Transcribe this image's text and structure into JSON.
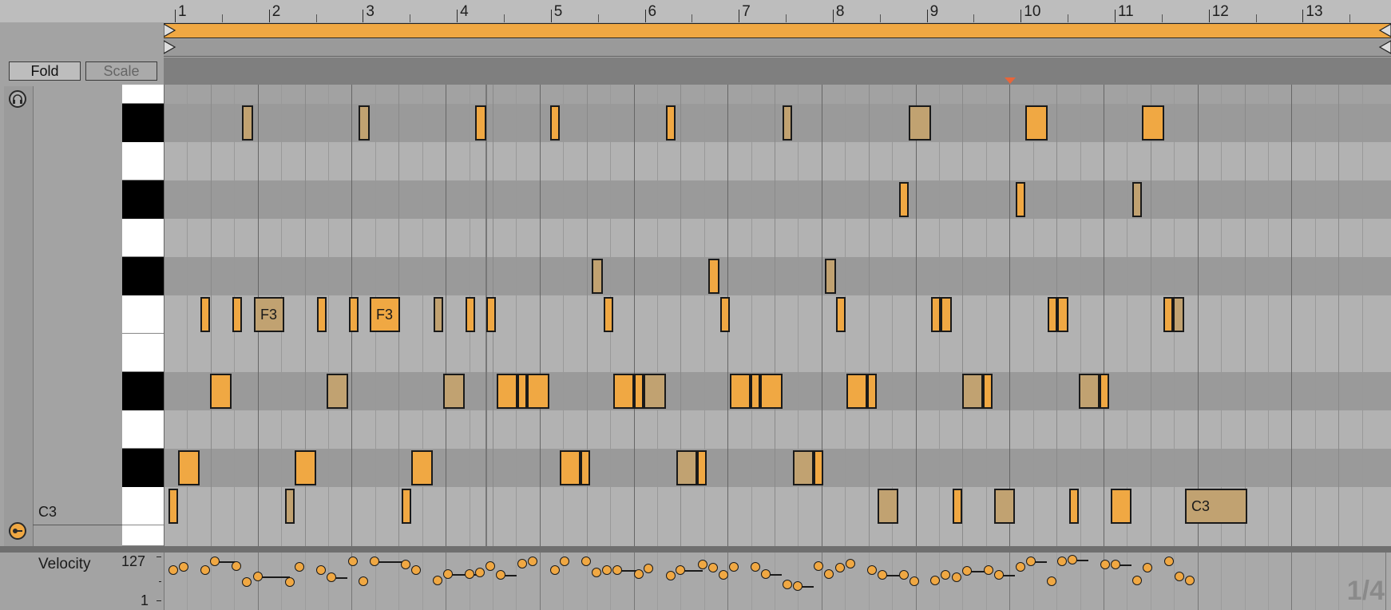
{
  "buttons": {
    "fold": "Fold",
    "scale": "Scale"
  },
  "key_label": "C3",
  "ruler": {
    "bars": [
      "1",
      "2",
      "3",
      "4",
      "5",
      "6",
      "7",
      "8",
      "9",
      "10",
      "11",
      "12",
      "13"
    ]
  },
  "velocity": {
    "label": "Velocity",
    "max": "127",
    "min": "1"
  },
  "page_indicator": "1/4",
  "note_labels": {
    "f3": "F3",
    "c3": "C3"
  },
  "colors": {
    "note": "#f0a843",
    "note_dim": "#cc9a55",
    "note_tan": "#c1a271",
    "loop": "#f0a843",
    "playhead": "#e8653a"
  },
  "icons": {
    "headphones": "headphones-icon",
    "fold_toggle": "fold-toggle-icon",
    "velocity_lane": "velocity-lane-icon",
    "preview": "play-icon"
  }
}
